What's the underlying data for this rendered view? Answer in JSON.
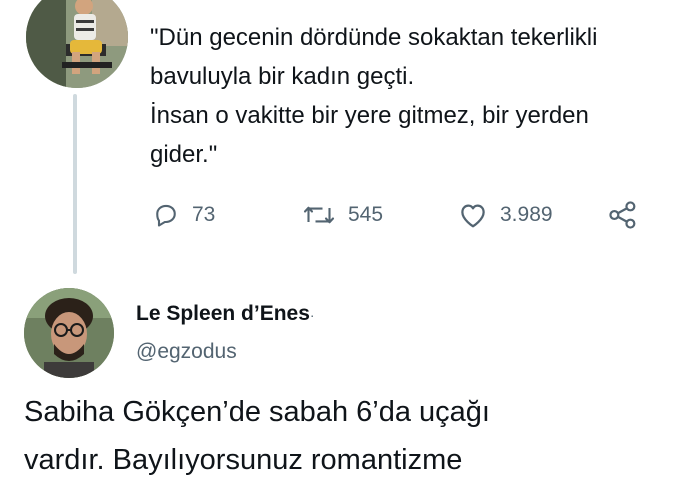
{
  "thread": {
    "tweet_lines": [
      "\"Dün gecenin dördünde sokaktan tekerlikli",
      "bavuluyla bir kadın geçti.",
      "İnsan o vakitte bir yere gitmez, bir yerden",
      "gider.\""
    ],
    "actions": {
      "replies": "73",
      "retweets": "545",
      "likes": "3.989"
    }
  },
  "reply": {
    "display_name": "Le Spleen d’Enes",
    "name_suffix": "·",
    "handle": "@egzodus",
    "tweet_lines": [
      "Sabiha Gökçen’de sabah 6’da uçağı",
      "vardır. Bayılıyorsunuz romantizme"
    ]
  },
  "colors": {
    "text": "#0f1419",
    "secondary": "#536471",
    "thread_line": "#cfd9de",
    "background": "#ffffff"
  },
  "icons": [
    "reply-icon",
    "retweet-icon",
    "like-icon",
    "share-icon"
  ]
}
